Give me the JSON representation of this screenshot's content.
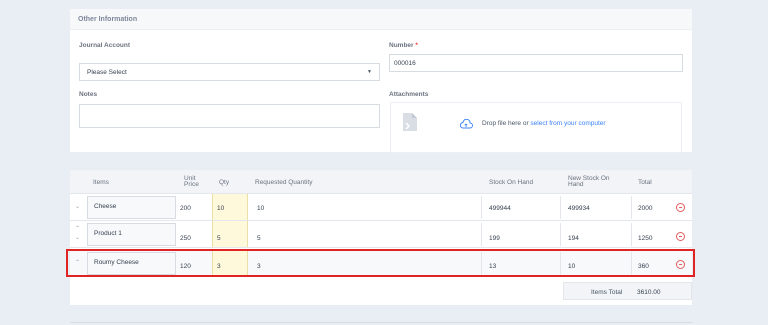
{
  "section": {
    "title": "Other Information",
    "journal_account": {
      "label": "Journal Account",
      "value": "Please Select"
    },
    "number": {
      "label": "Number",
      "required_mark": "*",
      "value": "000016"
    },
    "notes": {
      "label": "Notes",
      "value": ""
    },
    "attachments": {
      "label": "Attachments",
      "drop_text": "Drop file here or",
      "drop_link": "select from your computer"
    }
  },
  "table": {
    "headers": {
      "items": "Items",
      "unit_price_1": "Unit",
      "unit_price_2": "Price",
      "qty": "Qty",
      "requested_quantity": "Requested Quantity",
      "stock_on_hand": "Stock On Hand",
      "new_stock_1": "New Stock On",
      "new_stock_2": "Hand",
      "total": "Total"
    },
    "rows": [
      {
        "item": "Cheese",
        "unit_price": "200",
        "qty": "10",
        "requested_quantity": "10",
        "stock_on_hand": "499944",
        "new_stock_on_hand": "499934",
        "total": "2000"
      },
      {
        "item": "Product 1",
        "unit_price": "250",
        "qty": "5",
        "requested_quantity": "5",
        "stock_on_hand": "199",
        "new_stock_on_hand": "194",
        "total": "1250"
      },
      {
        "item": "Roumy Cheese",
        "unit_price": "120",
        "qty": "3",
        "requested_quantity": "3",
        "stock_on_hand": "13",
        "new_stock_on_hand": "10",
        "total": "360"
      }
    ],
    "items_total": {
      "label": "Items Total",
      "value": "3610.00"
    }
  },
  "colors": {
    "accent": "#3b82f6",
    "danger": "#e25c5c",
    "highlight": "#e02424",
    "qty_bg": "#fff9dc"
  },
  "icons": {
    "caret": "caret-down-icon",
    "file": "file-icon",
    "cloud": "cloud-upload-icon",
    "remove": "remove-circle-icon",
    "move_up": "chevron-up-icon",
    "move_down": "chevron-down-icon"
  }
}
